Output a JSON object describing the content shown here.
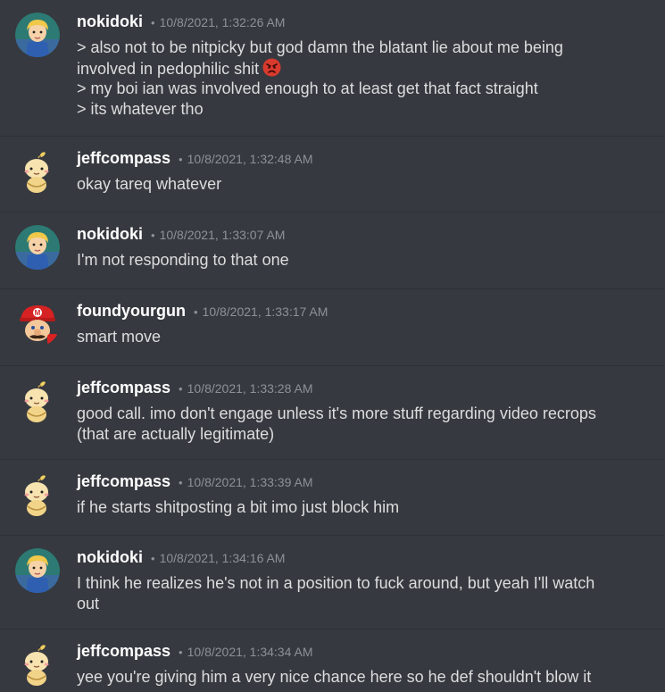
{
  "separator": "•",
  "messages": [
    {
      "username": "nokidoki",
      "timestamp": "10/8/2021, 1:32:26 AM",
      "lines": [
        "> also not to be nitpicky but god damn the blatant lie about me being",
        "involved in pedophilic shit",
        "> my boi ian was involved enough to at least get that fact straight",
        "> its whatever tho"
      ],
      "emoji": "angry-face-icon"
    },
    {
      "username": "jeffcompass",
      "timestamp": "10/8/2021, 1:32:48 AM",
      "lines": [
        "okay tareq whatever"
      ]
    },
    {
      "username": "nokidoki",
      "timestamp": "10/8/2021, 1:33:07 AM",
      "lines": [
        "I'm not responding to that one"
      ]
    },
    {
      "username": "foundyourgun",
      "timestamp": "10/8/2021, 1:33:17 AM",
      "lines": [
        "smart move"
      ]
    },
    {
      "username": "jeffcompass",
      "timestamp": "10/8/2021, 1:33:28 AM",
      "lines": [
        "good call. imo don't engage unless it's more stuff regarding video recrops",
        "(that are actually legitimate)"
      ]
    },
    {
      "username": "jeffcompass",
      "timestamp": "10/8/2021, 1:33:39 AM",
      "lines": [
        "if he starts shitposting a bit imo just block him"
      ]
    },
    {
      "username": "nokidoki",
      "timestamp": "10/8/2021, 1:34:16 AM",
      "lines": [
        "I think he realizes he's not in a position to fuck around, but yeah I'll watch",
        "out"
      ]
    },
    {
      "username": "jeffcompass",
      "timestamp": "10/8/2021, 1:34:34 AM",
      "lines": [
        "yee you're giving him a very nice chance here so he def shouldn't blow it"
      ]
    }
  ]
}
